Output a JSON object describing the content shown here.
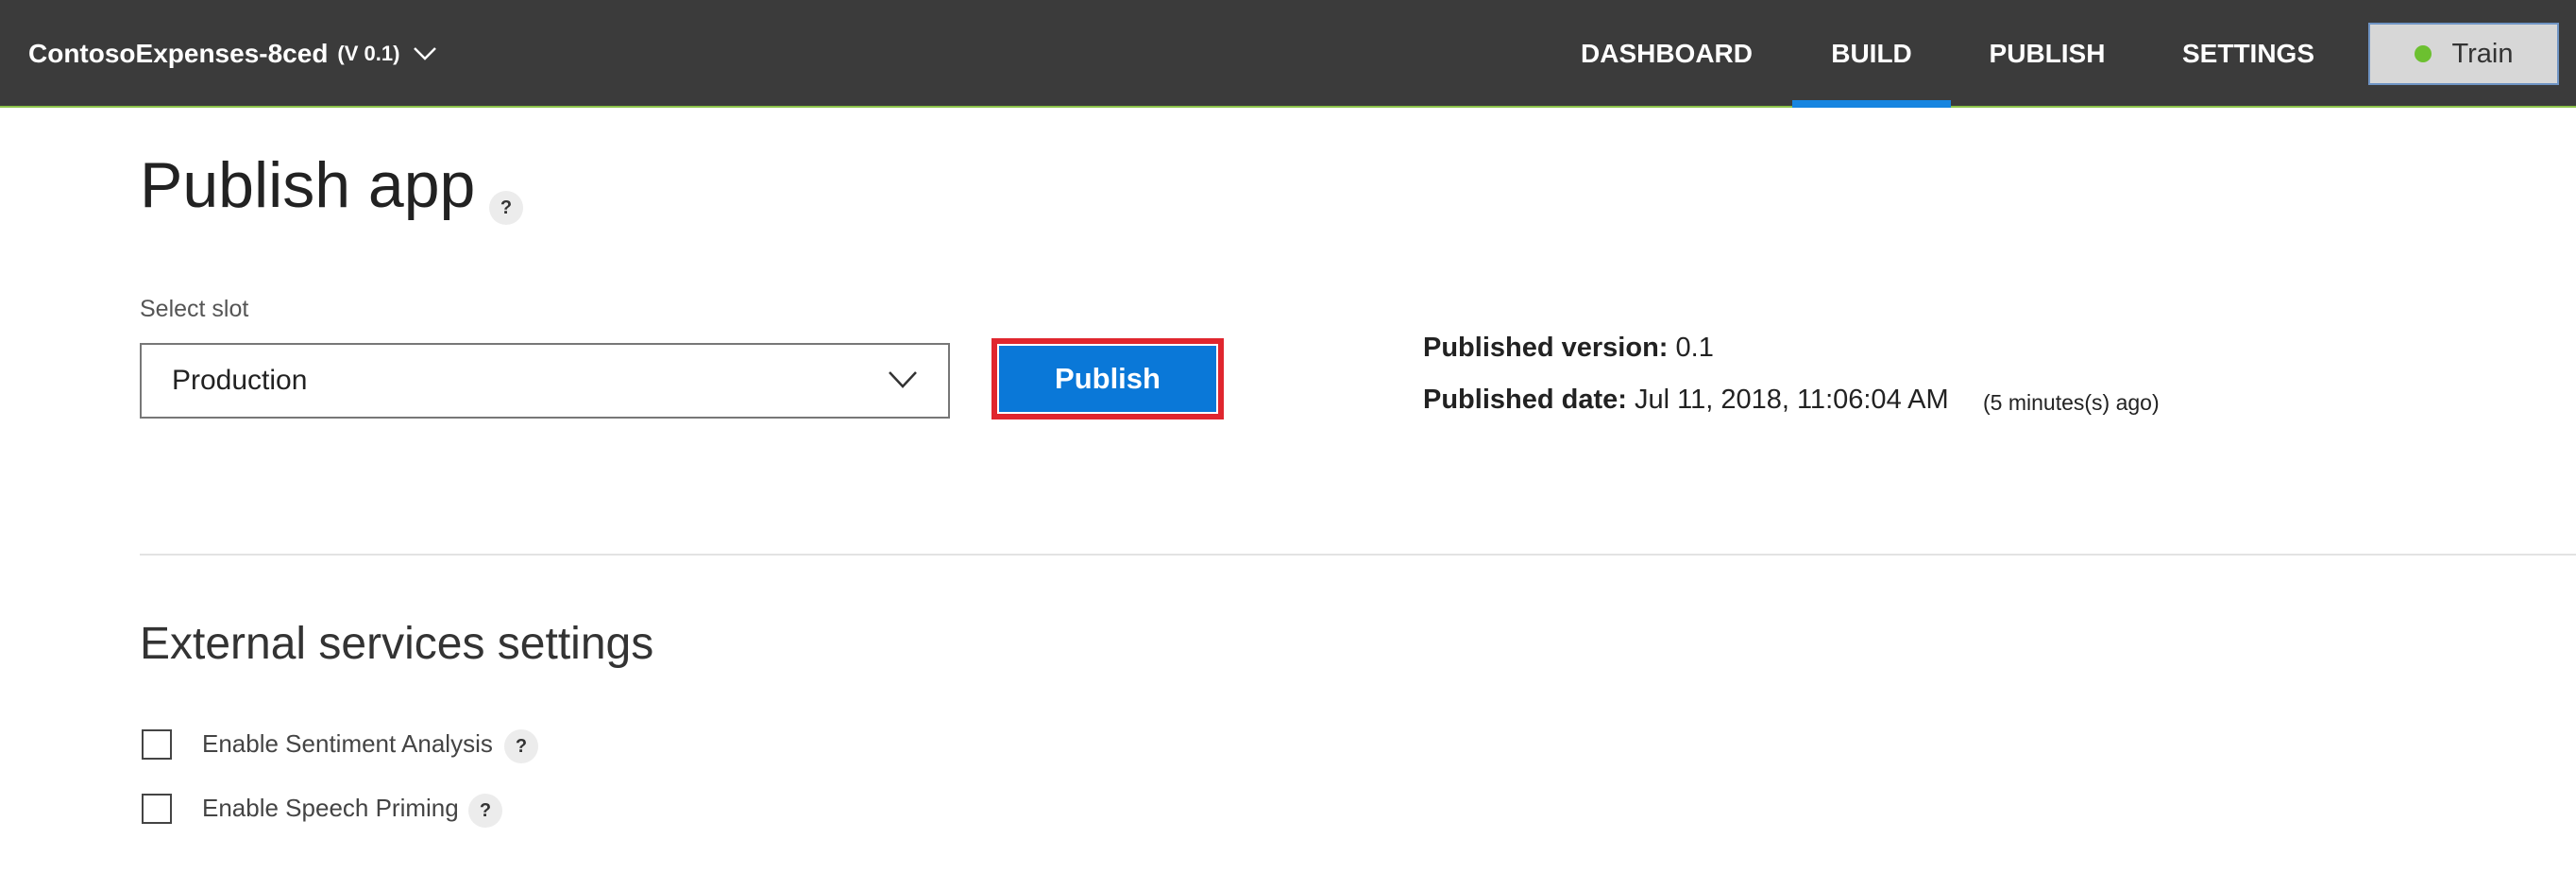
{
  "header": {
    "app_name": "ContosoExpenses-8ced",
    "app_version": "(V 0.1)",
    "nav": [
      {
        "label": "DASHBOARD",
        "active": false
      },
      {
        "label": "BUILD",
        "active": true
      },
      {
        "label": "PUBLISH",
        "active": false
      },
      {
        "label": "SETTINGS",
        "active": false
      }
    ],
    "train_label": "Train"
  },
  "main": {
    "title": "Publish app",
    "help_glyph": "?",
    "slot_label": "Select slot",
    "slot_value": "Production",
    "publish_label": "Publish",
    "published_version_label": "Published version:",
    "published_version_value": "0.1",
    "published_date_label": "Published date:",
    "published_date_value": "Jul 11, 2018, 11:06:04 AM",
    "published_ago": "(5 minutes(s) ago)"
  },
  "external": {
    "title": "External services settings",
    "options": [
      {
        "label": "Enable Sentiment Analysis",
        "checked": false
      },
      {
        "label": "Enable Speech Priming",
        "checked": false
      }
    ]
  },
  "colors": {
    "topbar_bg": "#3b3b3b",
    "active_tab_underline": "#1785e0",
    "publish_button_bg": "#0a78d8",
    "highlight_border": "#e0262e",
    "train_status_dot": "#6cc030"
  },
  "icons": {
    "app_switcher": "chevron-down-icon",
    "slot_dropdown": "chevron-down-icon",
    "train_status": "status-dot-icon",
    "help": "help-icon"
  }
}
